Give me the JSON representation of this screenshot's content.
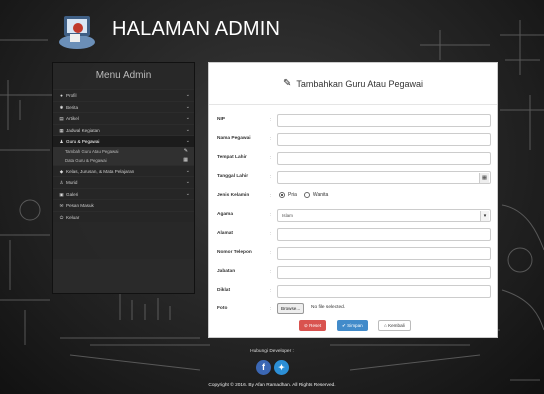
{
  "header": {
    "title": "HALAMAN ADMIN"
  },
  "sidebar": {
    "title": "Menu Admin",
    "items": [
      {
        "icon": "user-icon",
        "label": "Profil"
      },
      {
        "icon": "gear-icon",
        "label": "Berita"
      },
      {
        "icon": "newspaper-icon",
        "label": "Artikel"
      },
      {
        "icon": "calendar-icon",
        "label": "Jadwal Kegiatan"
      },
      {
        "icon": "users-icon",
        "label": "Guru & Pegawai"
      },
      {
        "icon": "bookmark-icon",
        "label": "Kelas, Jurusan, & Mata Pelajaran"
      },
      {
        "icon": "student-icon",
        "label": "Murid"
      },
      {
        "icon": "image-icon",
        "label": "Galeri"
      },
      {
        "icon": "envelope-icon",
        "label": "Pesan Masuk"
      },
      {
        "icon": "power-icon",
        "label": "Keluar"
      }
    ],
    "subitems": [
      {
        "label": "Tambah Guru Atau Pegawai",
        "icon": "pencil-icon"
      },
      {
        "label": "Data Guru & Pegawai",
        "icon": "table-icon"
      }
    ]
  },
  "form": {
    "title": "Tambahkan Guru Atau Pegawai",
    "fields": {
      "nip": {
        "label": "NIP",
        "value": ""
      },
      "nama": {
        "label": "Nama Pegawai",
        "value": ""
      },
      "tempat_lahir": {
        "label": "Tempat Lahir",
        "value": ""
      },
      "tanggal_lahir": {
        "label": "Tanggal Lahir",
        "value": ""
      },
      "jenis_kelamin": {
        "label": "Jenis Kelamin",
        "options": [
          "Pria",
          "Wanita"
        ],
        "selected": "Pria"
      },
      "agama": {
        "label": "Agama",
        "value": "Islam"
      },
      "alamat": {
        "label": "Alamat",
        "value": ""
      },
      "telepon": {
        "label": "Nomor Telepon",
        "value": ""
      },
      "jabatan": {
        "label": "Jabatan",
        "value": ""
      },
      "diklat": {
        "label": "Diklat",
        "value": ""
      },
      "foto": {
        "label": "Foto",
        "button": "Browse...",
        "status": "No file selected."
      }
    },
    "colon": ":",
    "buttons": {
      "reset": "Reset",
      "save": "Simpan",
      "back": "Kembali"
    }
  },
  "footer": {
    "label": "Hubungi Developer :",
    "copyright": "Copyright © 2016. By Afan Ramadhan. All Rights Reserved."
  },
  "colors": {
    "reset": "#d9534f",
    "save": "#428bca",
    "facebook": "#3b67b4",
    "twitter": "#2c8fd6"
  }
}
